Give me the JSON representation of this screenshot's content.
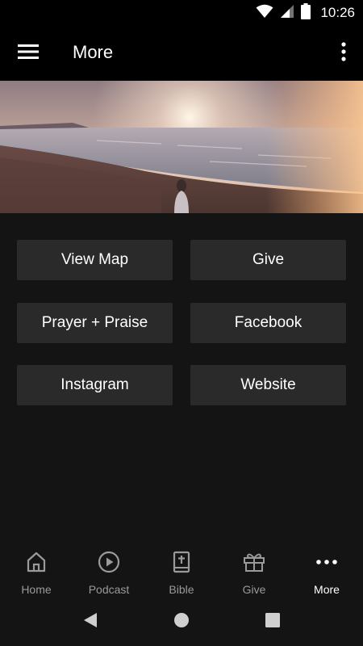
{
  "status_bar": {
    "time": "10:26"
  },
  "app_bar": {
    "title": "More"
  },
  "buttons": [
    {
      "label": "View Map"
    },
    {
      "label": "Give"
    },
    {
      "label": "Prayer + Praise"
    },
    {
      "label": "Facebook"
    },
    {
      "label": "Instagram"
    },
    {
      "label": "Website"
    }
  ],
  "bottom_nav": {
    "active": "More",
    "items": [
      {
        "label": "Home",
        "icon": "home-icon"
      },
      {
        "label": "Podcast",
        "icon": "play-circle-icon"
      },
      {
        "label": "Bible",
        "icon": "bible-icon"
      },
      {
        "label": "Give",
        "icon": "gift-icon"
      },
      {
        "label": "More",
        "icon": "more-horiz-icon"
      }
    ]
  },
  "colors": {
    "background": "#141414",
    "app_bar": "#000000",
    "button": "#2a2a2a",
    "nav_inactive": "#9a9a9a",
    "nav_active": "#ffffff"
  }
}
